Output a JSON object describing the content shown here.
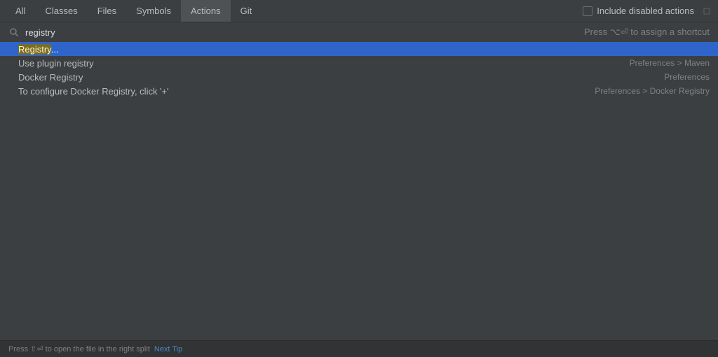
{
  "tabs": {
    "items": [
      {
        "label": "All",
        "active": false
      },
      {
        "label": "Classes",
        "active": false
      },
      {
        "label": "Files",
        "active": false
      },
      {
        "label": "Symbols",
        "active": false
      },
      {
        "label": "Actions",
        "active": true
      },
      {
        "label": "Git",
        "active": false
      }
    ]
  },
  "checkbox": {
    "label": "Include disabled actions"
  },
  "search": {
    "value": "registry",
    "hint": "Press ⌥⏎ to assign a shortcut"
  },
  "results": [
    {
      "label_prefix": "Registry",
      "label_suffix": "...",
      "highlighted": true,
      "location": "",
      "selected": true
    },
    {
      "label_prefix": "Use plugin ",
      "label_highlight": "registry",
      "label_suffix": "",
      "location": "Preferences > Maven",
      "selected": false
    },
    {
      "label_prefix": "Docker ",
      "label_highlight": "Registry",
      "label_suffix": "",
      "location": "Preferences",
      "selected": false
    },
    {
      "label_prefix": "To configure Docker ",
      "label_highlight": "Registry",
      "label_suffix": ", click '+'",
      "location": "Preferences > Docker Registry",
      "selected": false
    }
  ],
  "footer": {
    "hint": "Press ⇧⏎ to open the file in the right split",
    "link": "Next Tip"
  }
}
